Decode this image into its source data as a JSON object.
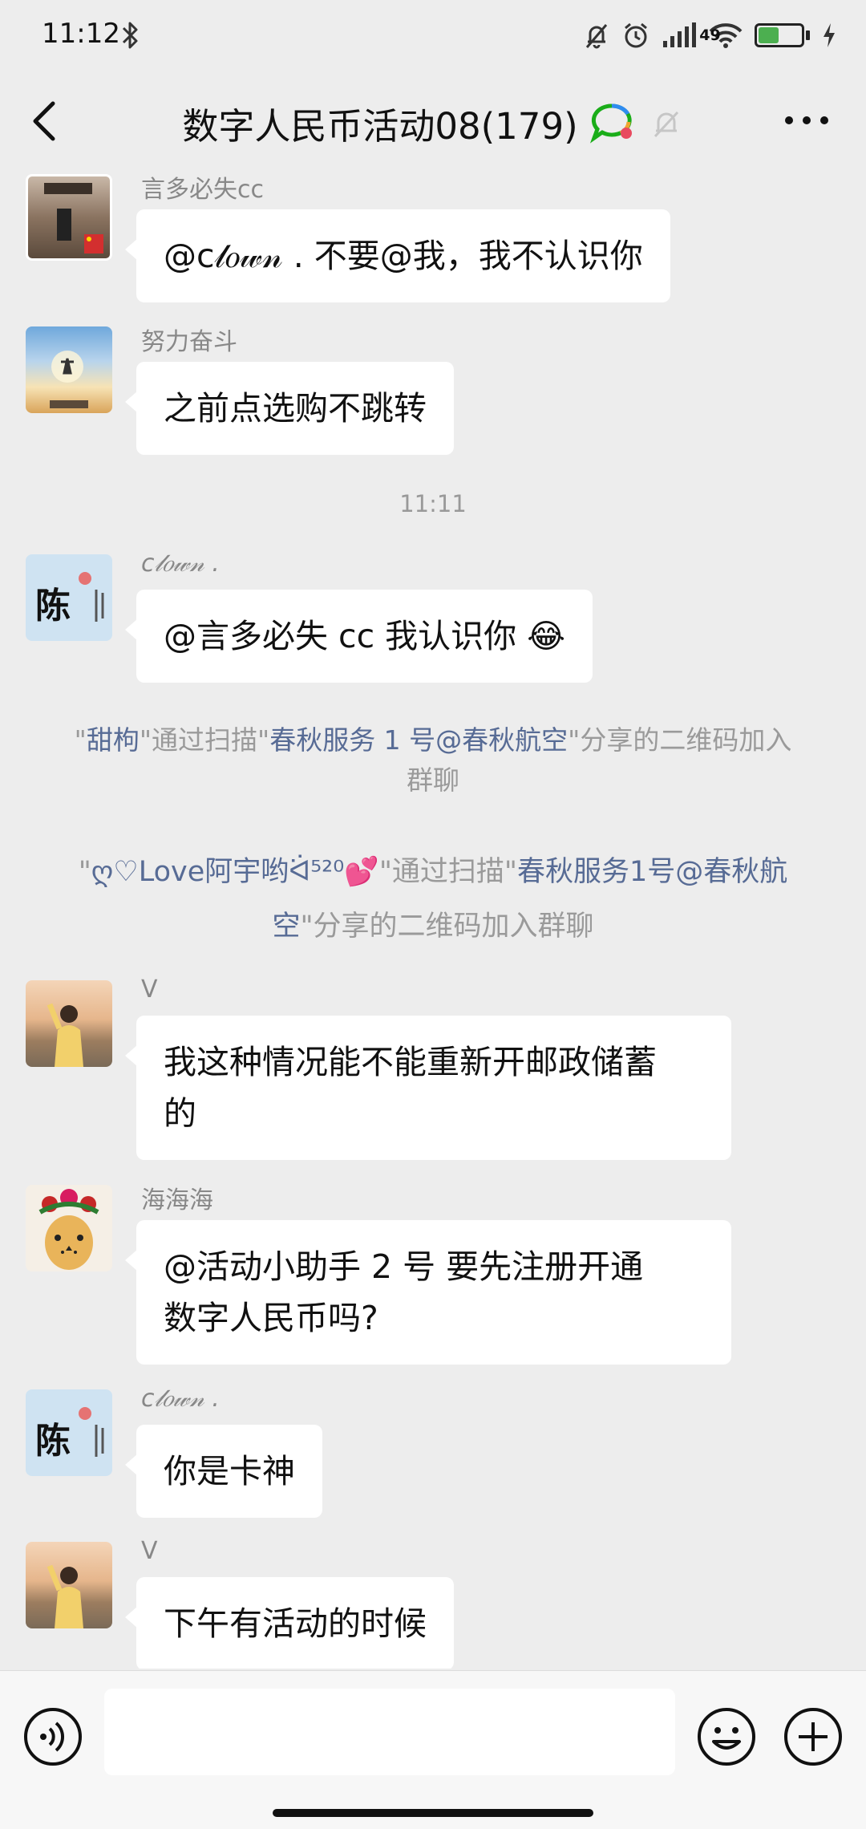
{
  "status_bar": {
    "time": "11:12",
    "battery": "49"
  },
  "header": {
    "title": "数字人民币活动08(179)"
  },
  "messages": [
    {
      "sender": "言多必失cc",
      "text": "@c𝓁𝑜𝓌𝓃 . 不要@我，我不认识你"
    },
    {
      "sender": "努力奋斗",
      "text": "之前点选购不跳转"
    },
    {
      "sender": "c𝓁𝑜𝓌𝓃 .",
      "text": "@言多必失 cc  我认识你 😂"
    },
    {
      "sender": "V",
      "text_line1": "我这种情况能不能重新开邮政储蓄",
      "text_line2": "的"
    },
    {
      "sender": "海海海",
      "text_line1": "@活动小助手 2 号   要先注册开通",
      "text_line2": "数字人民币吗?"
    },
    {
      "sender": "c𝓁𝑜𝓌𝓃 .",
      "text": "你是卡神"
    },
    {
      "sender": "V",
      "text": "下午有活动的时候"
    }
  ],
  "time_divider": "11:11",
  "system_messages": [
    {
      "q1": "\"",
      "name1": "甜枸",
      "mid1": "\"通过扫描\"",
      "name2": "春秋服务 1 号@春秋航空",
      "tail": "\"分享的二维码加入群聊"
    },
    {
      "q1": "\"",
      "name1": "ღ♡Love阿宇哟ᐛ⁵²⁰💕",
      "mid1": "\"通过扫描\"",
      "name2": "春秋服务1号@春秋航空",
      "tail": "\"分享的二维码加入群聊"
    }
  ],
  "avatar_labels": {
    "chen": "陈"
  }
}
